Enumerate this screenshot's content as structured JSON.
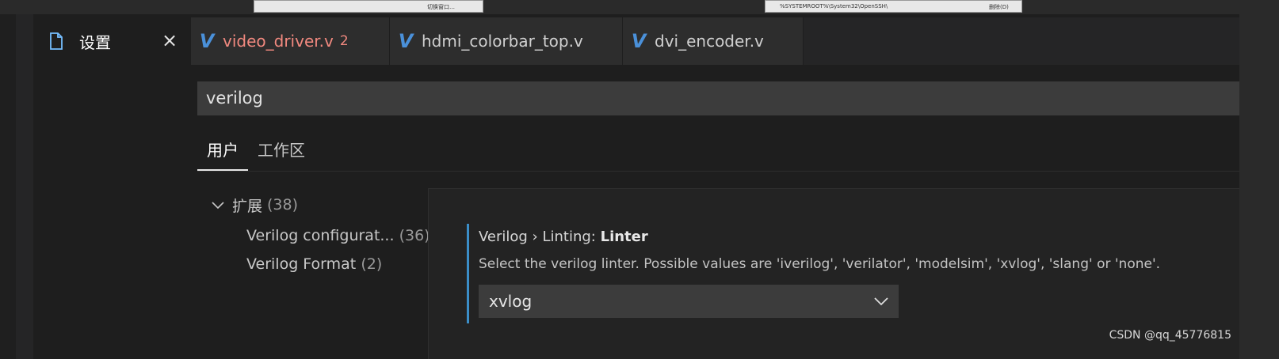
{
  "background_window": {
    "fragment_left": "切换窗口…",
    "fragment_middle": "%SYSTEMROOT%\\System32\\OpenSSH\\",
    "fragment_right": "删除(D)"
  },
  "tabs": [
    {
      "label": "设置",
      "icon": "file-icon",
      "active": true,
      "close": "×"
    },
    {
      "label": "video_driver.v",
      "icon": "verilog-icon",
      "badge": "2",
      "error": true
    },
    {
      "label": "hdmi_colorbar_top.v",
      "icon": "verilog-icon"
    },
    {
      "label": "dvi_encoder.v",
      "icon": "verilog-icon"
    }
  ],
  "search": {
    "value": "verilog"
  },
  "scope_tabs": [
    {
      "label": "用户",
      "selected": true
    },
    {
      "label": "工作区",
      "selected": false
    }
  ],
  "toc": {
    "group": {
      "label": "扩展",
      "count": "(38)"
    },
    "items": [
      {
        "label": "Verilog configurat...",
        "count": "(36)"
      },
      {
        "label": "Verilog Format",
        "count": "(2)"
      }
    ]
  },
  "setting": {
    "category": "Verilog › Linting: ",
    "name": "Linter",
    "description": "Select the verilog linter. Possible values are 'iverilog', 'verilator', 'modelsim', 'xvlog', 'slang' or 'none'.",
    "selected_value": "xvlog"
  },
  "watermark": "CSDN @qq_45776815",
  "colors": {
    "accent": "#3b8ec8",
    "error": "#f1897f",
    "verilog_logo": "#4a90d9"
  }
}
